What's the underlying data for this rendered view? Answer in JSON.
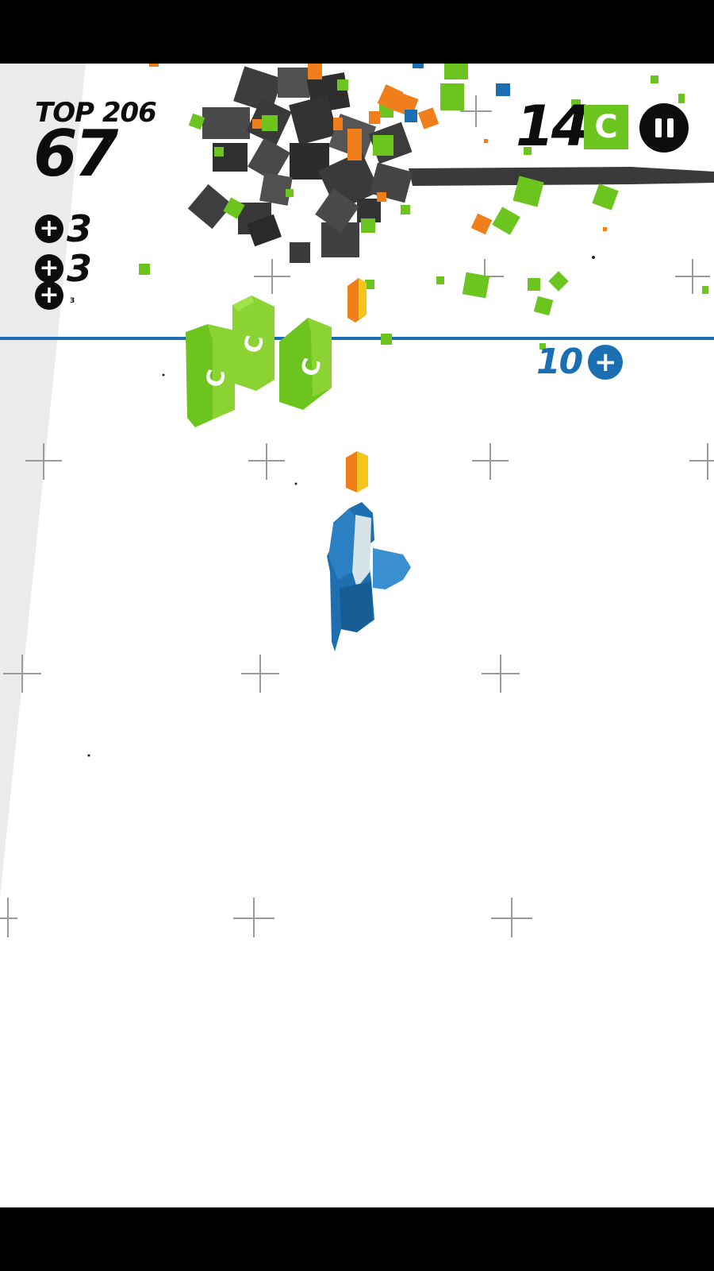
{
  "hud": {
    "top_label": "TOP 206",
    "score": "67",
    "bonuses": [
      {
        "sign": "+",
        "value": "3"
      },
      {
        "sign": "+",
        "value": "3"
      },
      {
        "sign": "+",
        "value": "",
        "small_value": "3"
      }
    ],
    "level": "14",
    "grade": "C",
    "pause_icon": "pause-icon"
  },
  "finish_line": {
    "value": "10",
    "sign": "+"
  },
  "blocks": {
    "letter": "C"
  },
  "colors": {
    "green": "#6cc41e",
    "orange": "#f07e1a",
    "blue": "#1a6fb3",
    "dark": "#3a3a3a"
  }
}
